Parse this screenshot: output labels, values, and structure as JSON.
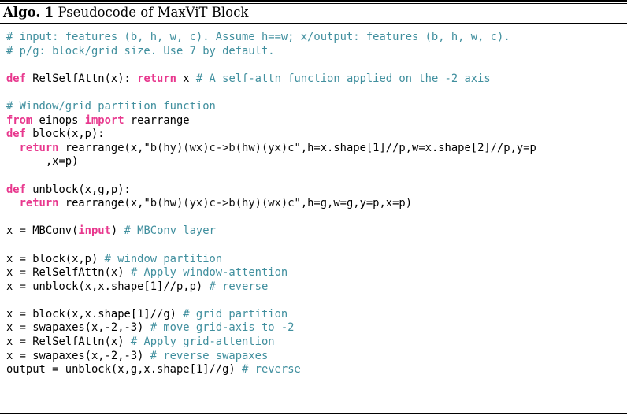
{
  "caption": {
    "label": "Algo. 1",
    "text": "Pseudocode of MaxViT Block"
  },
  "colors": {
    "keyword": "#e8388e",
    "comment": "#408f9e",
    "string": "#111111",
    "plain": "#000000",
    "rule": "#000000",
    "background": "#ffffff"
  },
  "code": {
    "language": "python",
    "lines": [
      {
        "id": 1,
        "blank": false,
        "tokens": [
          {
            "t": "# input: features (b, h, w, c). Assume h==w; x/output: features (b, h, w, c).",
            "k": "comment"
          }
        ]
      },
      {
        "id": 2,
        "blank": false,
        "tokens": [
          {
            "t": "# p/g: block/grid size. Use 7 by default.",
            "k": "comment"
          }
        ]
      },
      {
        "id": 3,
        "blank": true,
        "tokens": []
      },
      {
        "id": 4,
        "blank": false,
        "tokens": [
          {
            "t": "def",
            "k": "kw"
          },
          {
            "t": " RelSelfAttn(x): ",
            "k": "plain"
          },
          {
            "t": "return",
            "k": "kw"
          },
          {
            "t": " x ",
            "k": "plain"
          },
          {
            "t": "# A self-attn function applied on the -2 axis",
            "k": "comment"
          }
        ]
      },
      {
        "id": 5,
        "blank": true,
        "tokens": []
      },
      {
        "id": 6,
        "blank": false,
        "tokens": [
          {
            "t": "# Window/grid partition function",
            "k": "comment"
          }
        ]
      },
      {
        "id": 7,
        "blank": false,
        "tokens": [
          {
            "t": "from",
            "k": "kw"
          },
          {
            "t": " einops ",
            "k": "plain"
          },
          {
            "t": "import",
            "k": "kw"
          },
          {
            "t": " rearrange",
            "k": "plain"
          }
        ]
      },
      {
        "id": 8,
        "blank": false,
        "tokens": [
          {
            "t": "def",
            "k": "kw"
          },
          {
            "t": " block(x,p):",
            "k": "plain"
          }
        ]
      },
      {
        "id": 9,
        "blank": false,
        "tokens": [
          {
            "t": "  ",
            "k": "plain"
          },
          {
            "t": "return",
            "k": "kw"
          },
          {
            "t": " rearrange(x,",
            "k": "plain"
          },
          {
            "t": "\"b(hy)(wx)c->b(hw)(yx)c\"",
            "k": "str"
          },
          {
            "t": ",h=x.shape[1]//p,w=x.shape[2]//p,y=p",
            "k": "plain"
          }
        ]
      },
      {
        "id": 10,
        "blank": false,
        "tokens": [
          {
            "t": "      ,x=p)",
            "k": "plain"
          }
        ]
      },
      {
        "id": 11,
        "blank": true,
        "tokens": []
      },
      {
        "id": 12,
        "blank": false,
        "tokens": [
          {
            "t": "def",
            "k": "kw"
          },
          {
            "t": " unblock(x,g,p):",
            "k": "plain"
          }
        ]
      },
      {
        "id": 13,
        "blank": false,
        "tokens": [
          {
            "t": "  ",
            "k": "plain"
          },
          {
            "t": "return",
            "k": "kw"
          },
          {
            "t": " rearrange(x,",
            "k": "plain"
          },
          {
            "t": "\"b(hw)(yx)c->b(hy)(wx)c\"",
            "k": "str"
          },
          {
            "t": ",h=g,w=g,y=p,x=p)",
            "k": "plain"
          }
        ]
      },
      {
        "id": 14,
        "blank": true,
        "tokens": []
      },
      {
        "id": 15,
        "blank": false,
        "tokens": [
          {
            "t": "x = MBConv(",
            "k": "plain"
          },
          {
            "t": "input",
            "k": "kw"
          },
          {
            "t": ") ",
            "k": "plain"
          },
          {
            "t": "# MBConv layer",
            "k": "comment"
          }
        ]
      },
      {
        "id": 16,
        "blank": true,
        "tokens": []
      },
      {
        "id": 17,
        "blank": false,
        "tokens": [
          {
            "t": "x = block(x,p) ",
            "k": "plain"
          },
          {
            "t": "# window partition",
            "k": "comment"
          }
        ]
      },
      {
        "id": 18,
        "blank": false,
        "tokens": [
          {
            "t": "x = RelSelfAttn(x) ",
            "k": "plain"
          },
          {
            "t": "# Apply window-attention",
            "k": "comment"
          }
        ]
      },
      {
        "id": 19,
        "blank": false,
        "tokens": [
          {
            "t": "x = unblock(x,x.shape[1]//p,p) ",
            "k": "plain"
          },
          {
            "t": "# reverse",
            "k": "comment"
          }
        ]
      },
      {
        "id": 20,
        "blank": true,
        "tokens": []
      },
      {
        "id": 21,
        "blank": false,
        "tokens": [
          {
            "t": "x = block(x,x.shape[1]//g) ",
            "k": "plain"
          },
          {
            "t": "# grid partition",
            "k": "comment"
          }
        ]
      },
      {
        "id": 22,
        "blank": false,
        "tokens": [
          {
            "t": "x = swapaxes(x,-2,-3) ",
            "k": "plain"
          },
          {
            "t": "# move grid-axis to -2",
            "k": "comment"
          }
        ]
      },
      {
        "id": 23,
        "blank": false,
        "tokens": [
          {
            "t": "x = RelSelfAttn(x) ",
            "k": "plain"
          },
          {
            "t": "# Apply grid-attention",
            "k": "comment"
          }
        ]
      },
      {
        "id": 24,
        "blank": false,
        "tokens": [
          {
            "t": "x = swapaxes(x,-2,-3) ",
            "k": "plain"
          },
          {
            "t": "# reverse swapaxes",
            "k": "comment"
          }
        ]
      },
      {
        "id": 25,
        "blank": false,
        "tokens": [
          {
            "t": "output = unblock(x,g,x.shape[1]//g) ",
            "k": "plain"
          },
          {
            "t": "# reverse",
            "k": "comment"
          }
        ]
      }
    ]
  }
}
